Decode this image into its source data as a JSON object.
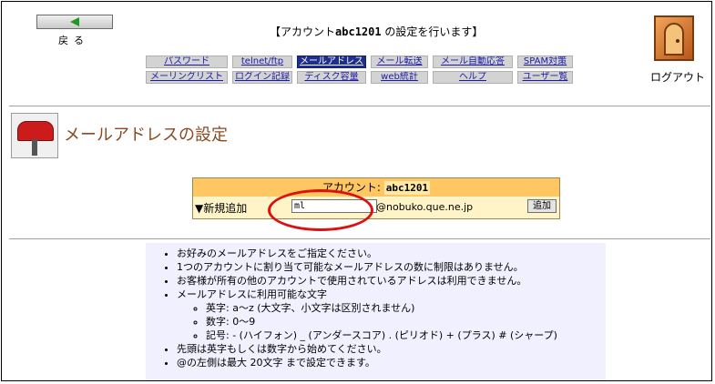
{
  "header": {
    "back_label": "戻る",
    "title_prefix": "【アカウント",
    "account": "abc1201",
    "title_suffix": " の設定を行います】",
    "logout_label": "ログアウト"
  },
  "nav": {
    "row1": [
      {
        "label": "パスワード",
        "active": false
      },
      {
        "label": "telnet/ftp",
        "active": false
      },
      {
        "label": "メールアドレス",
        "active": true
      },
      {
        "label": "メール転送",
        "active": false
      },
      {
        "label": "メール自動応答",
        "active": false
      },
      {
        "label": "SPAM対策",
        "active": false
      }
    ],
    "row2": [
      {
        "label": "メーリングリスト",
        "active": false
      },
      {
        "label": "ログイン記録",
        "active": false
      },
      {
        "label": "ディスク容量",
        "active": false
      },
      {
        "label": "web統計",
        "active": false
      },
      {
        "label": "ヘルプ",
        "active": false
      },
      {
        "label": "ユーザー覧",
        "active": false
      }
    ]
  },
  "page": {
    "title": "メールアドレスの設定"
  },
  "form": {
    "account_label": "アカウント: ",
    "account_value": "abc1201",
    "new_label": "▼新規追加",
    "input_value": "ml",
    "domain": "@nobuko.que.ne.jp",
    "add_button": "追加"
  },
  "notes": {
    "item1": "お好みのメールアドレスをご指定ください。",
    "item2": "1つのアカウントに割り当て可能なメールアドレスの数に制限はありません。",
    "item3": "お客様が所有の他のアカウントで使用されているアドレスは利用できません。",
    "item4": "メールアドレスに利用可能な文字",
    "sub1": "英字: a〜z (大文字、小文字は区別されません)",
    "sub2": "数字: 0〜9",
    "sub3": "記号: - (ハイフォン) _ (アンダースコア) . (ピリオド) + (プラス) # (シャープ)",
    "item5": "先頭は英字もしくは数字から始めてください。",
    "item6": "@の左側は最大 20文字 まで設定できます。"
  },
  "colors": {
    "active_nav": "#1f2f8f",
    "form_head": "#ffc763",
    "highlight": "#dd1111"
  }
}
